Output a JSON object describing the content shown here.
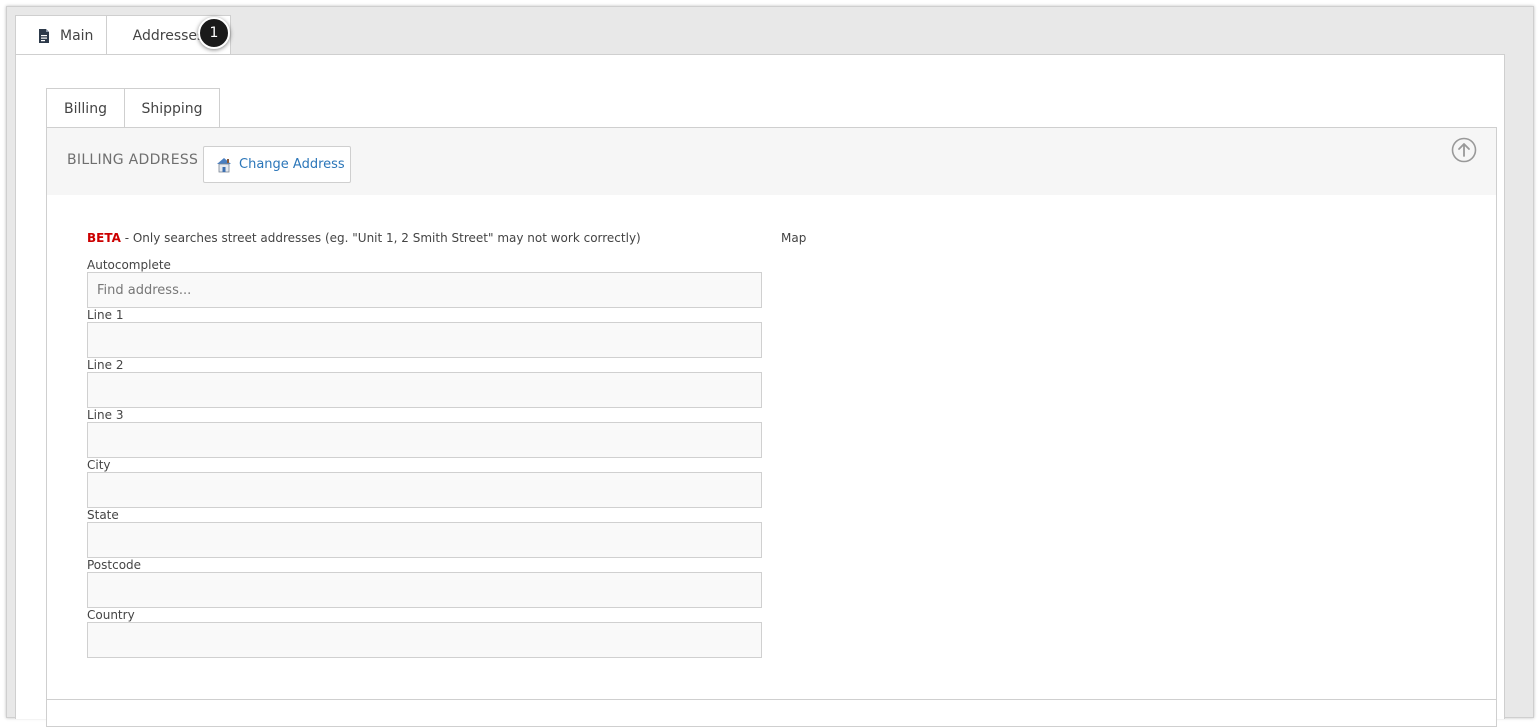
{
  "top_tabs": [
    {
      "label": "Main",
      "icon": "document-icon"
    },
    {
      "label": "Addresses"
    }
  ],
  "callout": "1",
  "sub_tabs": [
    {
      "label": "Billing"
    },
    {
      "label": "Shipping"
    }
  ],
  "panel": {
    "title": "BILLING ADDRESS",
    "change_button": "Change Address"
  },
  "beta": {
    "tag": "BETA",
    "text": " - Only searches street addresses (eg. \"Unit 1, 2 Smith Street\" may not work correctly)"
  },
  "map_label": "Map",
  "fields": [
    {
      "label": "Autocomplete",
      "placeholder": "Find address...",
      "value": ""
    },
    {
      "label": "Line 1",
      "value": ""
    },
    {
      "label": "Line 2",
      "value": ""
    },
    {
      "label": "Line 3",
      "value": ""
    },
    {
      "label": "City",
      "value": ""
    },
    {
      "label": "State",
      "value": ""
    },
    {
      "label": "Postcode",
      "value": ""
    },
    {
      "label": "Country",
      "value": ""
    }
  ],
  "colors": {
    "beta": "#cc0000",
    "link": "#2b76b9",
    "callout_bg": "#1a1a1a"
  }
}
